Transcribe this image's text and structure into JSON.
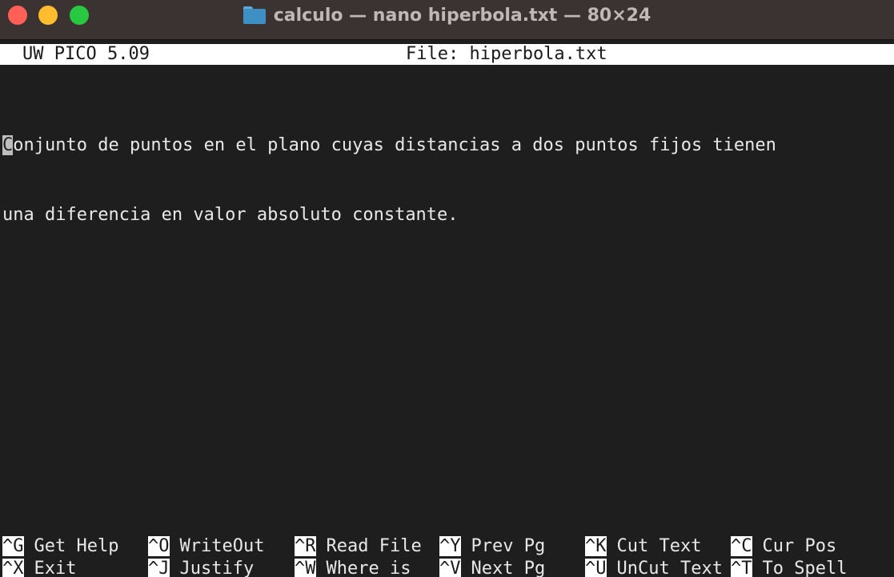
{
  "window": {
    "title": "calculo — nano hiperbola.txt — 80×24",
    "icon": "folder-icon",
    "traffic_lights": {
      "close": "#fe5f57",
      "minimize": "#febc2e",
      "zoom": "#28c840"
    }
  },
  "editor": {
    "version": "UW PICO 5.09",
    "file_label": "File: hiperbola.txt",
    "cursor_char": "C",
    "lines": [
      "onjunto de puntos en el plano cuyas distancias a dos puntos fijos tienen",
      "una diferencia en valor absoluto constante."
    ]
  },
  "shortcuts": {
    "row1": [
      {
        "key": "^G",
        "label": "Get Help"
      },
      {
        "key": "^O",
        "label": "WriteOut"
      },
      {
        "key": "^R",
        "label": "Read File"
      },
      {
        "key": "^Y",
        "label": "Prev Pg"
      },
      {
        "key": "^K",
        "label": "Cut Text"
      },
      {
        "key": "^C",
        "label": "Cur Pos"
      }
    ],
    "row2": [
      {
        "key": "^X",
        "label": "Exit"
      },
      {
        "key": "^J",
        "label": "Justify"
      },
      {
        "key": "^W",
        "label": "Where is"
      },
      {
        "key": "^V",
        "label": "Next Pg"
      },
      {
        "key": "^U",
        "label": "UnCut Text"
      },
      {
        "key": "^T",
        "label": "To Spell"
      }
    ]
  },
  "colors": {
    "background": "#1e1e1e",
    "titlebar": "#3b3332",
    "text": "#e8e8e8",
    "inverse": "#ffffff"
  }
}
